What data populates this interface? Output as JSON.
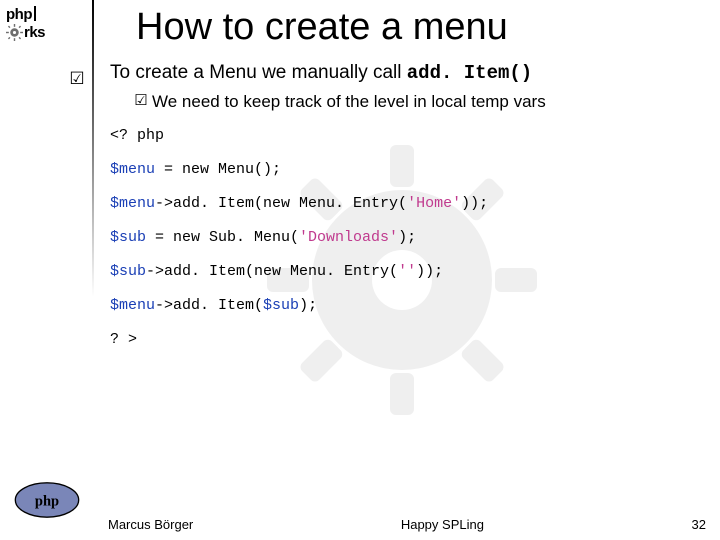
{
  "logo": {
    "php": "php",
    "works": "rks"
  },
  "title": "How to create a menu",
  "bullet1_pre": "To create a Menu we manually call ",
  "bullet1_mono": "add. Item()",
  "bullet2": "We need to keep track of the level in local temp vars",
  "code": {
    "l1": "<? php",
    "l2a": "$menu",
    "l2b": " = new Menu();",
    "l3a": "$menu",
    "l3b": "->add. Item(new Menu. Entry(",
    "l3c": "'Home'",
    "l3d": "));",
    "l4a": "$sub",
    "l4b": " = new Sub. Menu(",
    "l4c": "'Downloads'",
    "l4d": ");",
    "l5a": "$sub",
    "l5b": "->add. Item(new Menu. Entry(",
    "l5c": "''",
    "l5d": "));",
    "l6a": "$menu",
    "l6b": "->add. Item(",
    "l6c": "$sub",
    "l6d": ");",
    "l7": "? >"
  },
  "footer": {
    "author": "Marcus Börger",
    "center": "Happy SPLing",
    "page": "32"
  }
}
